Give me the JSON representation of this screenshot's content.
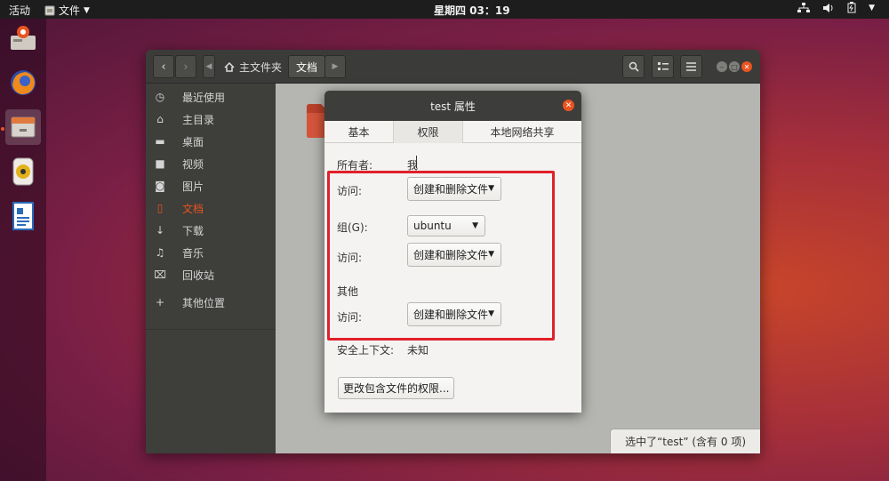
{
  "topbar": {
    "activities": "活动",
    "app_menu": "文件",
    "clock": "星期四 03：19"
  },
  "dock": {
    "items": [
      "installer-icon",
      "firefox-icon",
      "files-icon",
      "rhythmbox-icon",
      "writer-icon"
    ]
  },
  "files": {
    "breadcrumbs": [
      "主文件夹",
      "文档"
    ],
    "sidebar": [
      {
        "icon": "recent-icon",
        "label": "最近使用"
      },
      {
        "icon": "home-icon",
        "label": "主目录"
      },
      {
        "icon": "folder-icon",
        "label": "桌面"
      },
      {
        "icon": "video-icon",
        "label": "视频"
      },
      {
        "icon": "camera-icon",
        "label": "图片"
      },
      {
        "icon": "document-icon",
        "label": "文档"
      },
      {
        "icon": "download-icon",
        "label": "下载"
      },
      {
        "icon": "music-icon",
        "label": "音乐"
      },
      {
        "icon": "trash-icon",
        "label": "回收站"
      },
      {
        "icon": "plus-icon",
        "label": "其他位置"
      }
    ],
    "active_item": "文档",
    "status": "选中了“test” (含有 0 项)"
  },
  "dialog": {
    "title": "test 属性",
    "tabs": [
      "基本",
      "权限",
      "本地网络共享"
    ],
    "selected_tab": "权限",
    "owner_label": "所有者:",
    "owner_value": "我",
    "owner_access_label": "访问:",
    "owner_access_value": "创建和删除文件",
    "group_label": "组(G):",
    "group_value": "ubuntu",
    "group_access_label": "访问:",
    "group_access_value": "创建和删除文件",
    "others_label": "其他",
    "others_access_label": "访问:",
    "others_access_value": "创建和删除文件",
    "security_label": "安全上下文:",
    "security_value": "未知",
    "change_button": "更改包含文件的权限..."
  },
  "colors": {
    "accent": "#e95420",
    "highlight_box": "#e0202a"
  }
}
